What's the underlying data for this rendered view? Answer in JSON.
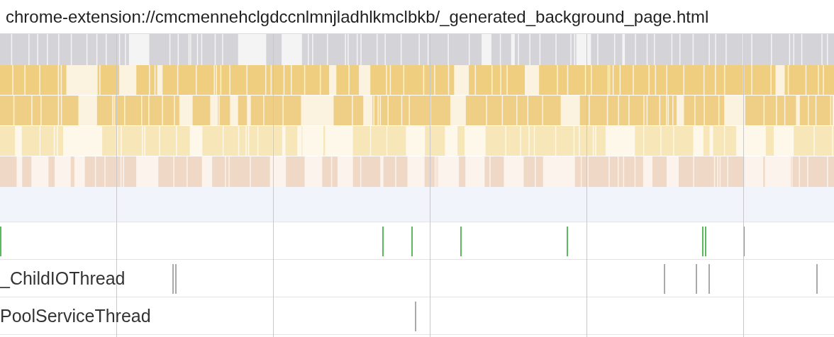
{
  "title": "chrome-extension://cmcmennehclgdccnlmnjladhlkmclbkb/_generated_background_page.html",
  "threads": [
    {
      "label": "_ChildIOThread"
    },
    {
      "label": "PoolServiceThread"
    }
  ]
}
